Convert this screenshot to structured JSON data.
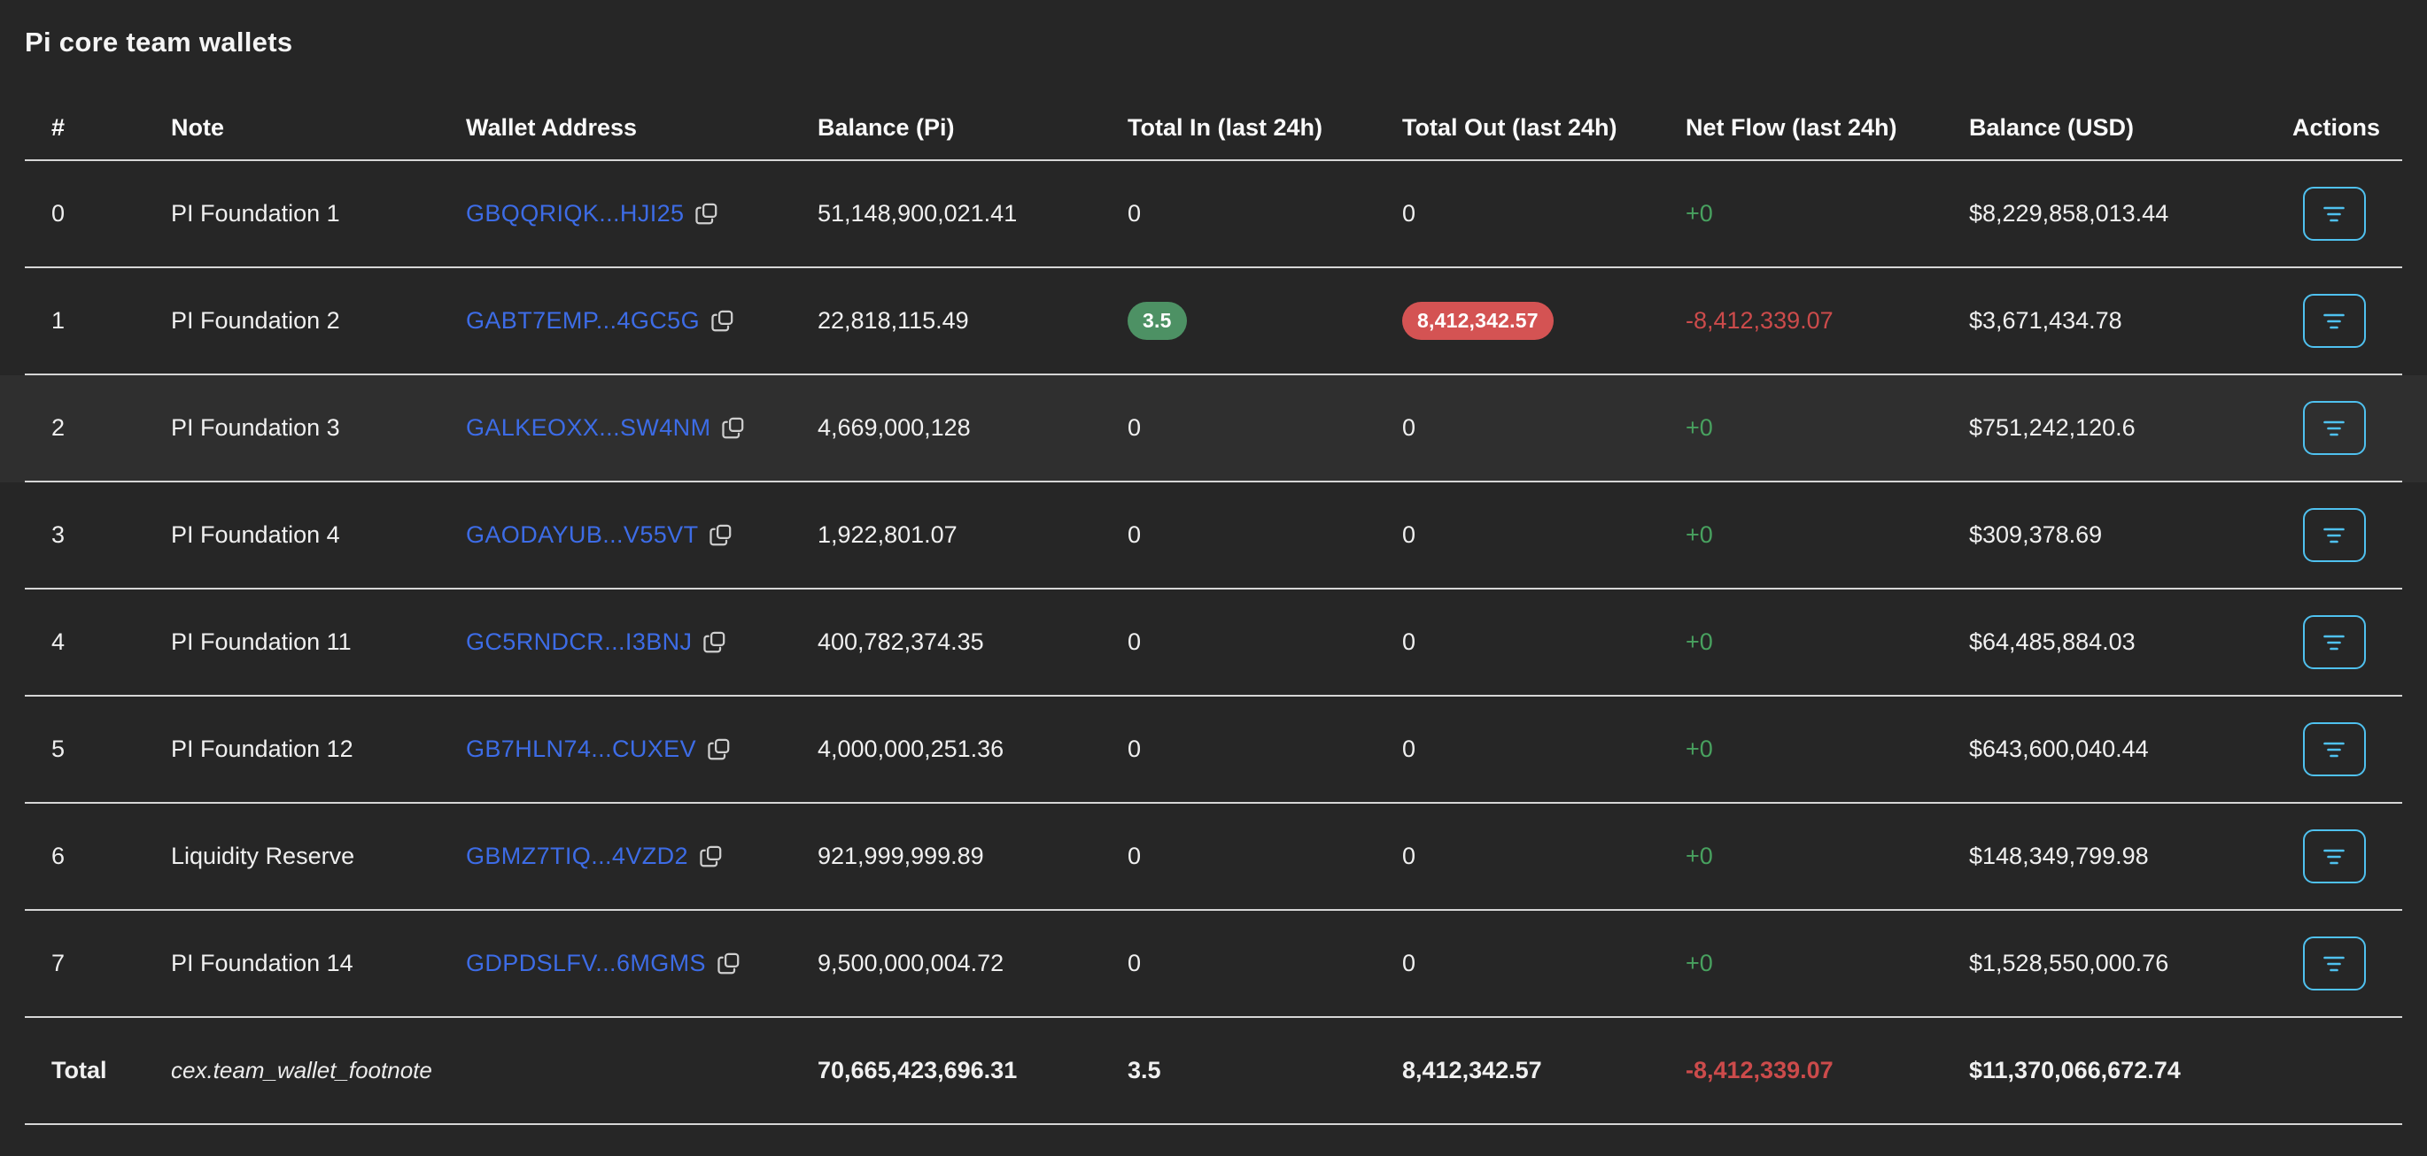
{
  "title": "Pi core team wallets",
  "colors": {
    "background": "#262626",
    "separator": "#d6d6d6",
    "text": "#f0f0f0",
    "link_blue": "#3d6ce6",
    "positive_green": "#48a15f",
    "negative_red": "#cc4b4b",
    "badge_green_bg": "#4d9164",
    "badge_red_bg": "#d45353",
    "accent_cyan": "#4fc1ef",
    "row_highlight": "rgba(255,255,255,0.045)"
  },
  "icons": {
    "copy": "copy-icon (two overlapping rounded squares)",
    "actions": "filter-lines-icon (three centered horizontal bars, decreasing width)"
  },
  "table": {
    "columns": [
      "#",
      "Note",
      "Wallet Address",
      "Balance (Pi)",
      "Total In (last 24h)",
      "Total Out (last 24h)",
      "Net Flow (last 24h)",
      "Balance (USD)",
      "Actions"
    ],
    "highlighted_row": 2,
    "rows": [
      {
        "index": "0",
        "note": "PI Foundation 1",
        "address": "GBQQRIQK...HJI25",
        "balance_pi": "51,148,900,021.41",
        "total_in": "0",
        "total_in_badge": false,
        "total_out": "0",
        "total_out_badge": false,
        "net_flow": "+0",
        "net_flow_negative": false,
        "balance_usd": "$8,229,858,013.44"
      },
      {
        "index": "1",
        "note": "PI Foundation 2",
        "address": "GABT7EMP...4GC5G",
        "balance_pi": "22,818,115.49",
        "total_in": "3.5",
        "total_in_badge": true,
        "total_out": "8,412,342.57",
        "total_out_badge": true,
        "net_flow": "-8,412,339.07",
        "net_flow_negative": true,
        "balance_usd": "$3,671,434.78"
      },
      {
        "index": "2",
        "note": "PI Foundation 3",
        "address": "GALKEOXX...SW4NM",
        "balance_pi": "4,669,000,128",
        "total_in": "0",
        "total_in_badge": false,
        "total_out": "0",
        "total_out_badge": false,
        "net_flow": "+0",
        "net_flow_negative": false,
        "balance_usd": "$751,242,120.6"
      },
      {
        "index": "3",
        "note": "PI Foundation 4",
        "address": "GAODAYUB...V55VT",
        "balance_pi": "1,922,801.07",
        "total_in": "0",
        "total_in_badge": false,
        "total_out": "0",
        "total_out_badge": false,
        "net_flow": "+0",
        "net_flow_negative": false,
        "balance_usd": "$309,378.69"
      },
      {
        "index": "4",
        "note": "PI Foundation 11",
        "address": "GC5RNDCR...I3BNJ",
        "balance_pi": "400,782,374.35",
        "total_in": "0",
        "total_in_badge": false,
        "total_out": "0",
        "total_out_badge": false,
        "net_flow": "+0",
        "net_flow_negative": false,
        "balance_usd": "$64,485,884.03"
      },
      {
        "index": "5",
        "note": "PI Foundation 12",
        "address": "GB7HLN74...CUXEV",
        "balance_pi": "4,000,000,251.36",
        "total_in": "0",
        "total_in_badge": false,
        "total_out": "0",
        "total_out_badge": false,
        "net_flow": "+0",
        "net_flow_negative": false,
        "balance_usd": "$643,600,040.44"
      },
      {
        "index": "6",
        "note": "Liquidity Reserve",
        "address": "GBMZ7TIQ...4VZD2",
        "balance_pi": "921,999,999.89",
        "total_in": "0",
        "total_in_badge": false,
        "total_out": "0",
        "total_out_badge": false,
        "net_flow": "+0",
        "net_flow_negative": false,
        "balance_usd": "$148,349,799.98"
      },
      {
        "index": "7",
        "note": "PI Foundation 14",
        "address": "GDPDSLFV...6MGMS",
        "balance_pi": "9,500,000,004.72",
        "total_in": "0",
        "total_in_badge": false,
        "total_out": "0",
        "total_out_badge": false,
        "net_flow": "+0",
        "net_flow_negative": false,
        "balance_usd": "$1,528,550,000.76"
      }
    ],
    "total": {
      "label": "Total",
      "footnote": "cex.team_wallet_footnote",
      "balance_pi": "70,665,423,696.31",
      "total_in": "3.5",
      "total_out": "8,412,342.57",
      "net_flow": "-8,412,339.07",
      "balance_usd": "$11,370,066,672.74"
    }
  }
}
